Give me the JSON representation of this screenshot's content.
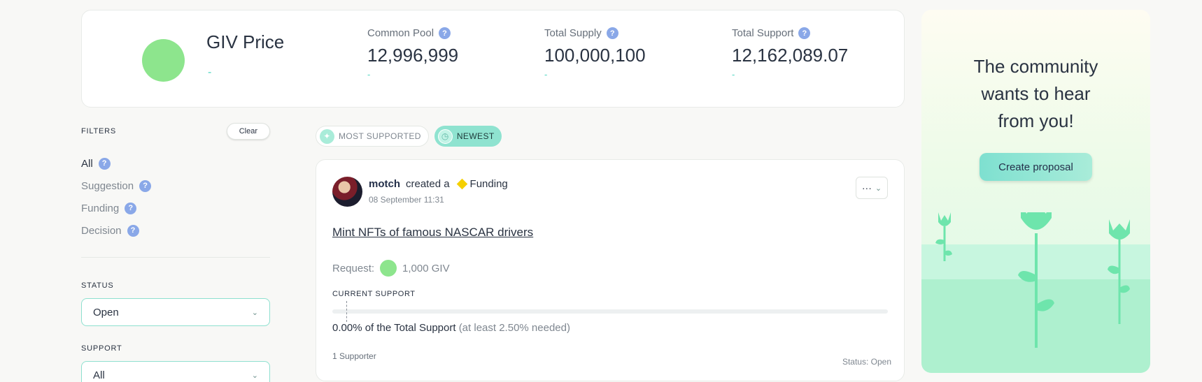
{
  "stats": {
    "giv_title": "GIV Price",
    "giv_sub": "-",
    "items": [
      {
        "label": "Common Pool",
        "value": "12,996,999",
        "sub": "-"
      },
      {
        "label": "Total Supply",
        "value": "100,000,100",
        "sub": "-"
      },
      {
        "label": "Total Support",
        "value": "12,162,089.07",
        "sub": "-"
      }
    ],
    "help_glyph": "?"
  },
  "filters": {
    "title": "FILTERS",
    "clear_label": "Clear",
    "items": [
      {
        "label": "All",
        "active": true
      },
      {
        "label": "Suggestion",
        "active": false
      },
      {
        "label": "Funding",
        "active": false
      },
      {
        "label": "Decision",
        "active": false
      }
    ],
    "status_title": "STATUS",
    "status_value": "Open",
    "support_title": "SUPPORT",
    "support_value": "All",
    "chevron": "⌄"
  },
  "sort_tabs": [
    {
      "label": "MOST SUPPORTED",
      "active": false,
      "icon": "sparkle-icon",
      "glyph": "✦"
    },
    {
      "label": "NEWEST",
      "active": true,
      "icon": "clock-icon",
      "glyph": "◷"
    }
  ],
  "proposal": {
    "author": "motch",
    "action": "created a",
    "type": "Funding",
    "timestamp": "08 September 11:31",
    "menu_glyph": "···",
    "menu_chevron": "⌄",
    "title": "Mint NFTs of famous NASCAR drivers",
    "request_label": "Request:",
    "request_amount": "1,000 GIV",
    "support_label": "CURRENT SUPPORT",
    "support_fraction": 0.0,
    "threshold_fraction": 0.025,
    "support_text": "0.00% of the Total Support",
    "needed_text": "(at least 2.50% needed)",
    "supporters": "1 Supporter",
    "status": "Status: Open"
  },
  "community": {
    "lines": [
      "The community",
      "wants to hear",
      "from you!"
    ],
    "button_label": "Create proposal"
  },
  "colors": {
    "accent": "#8fe3d0",
    "giv_green": "#8de58d",
    "help_blue": "#8aa8e8",
    "funding_diamond": "#f5d000"
  }
}
